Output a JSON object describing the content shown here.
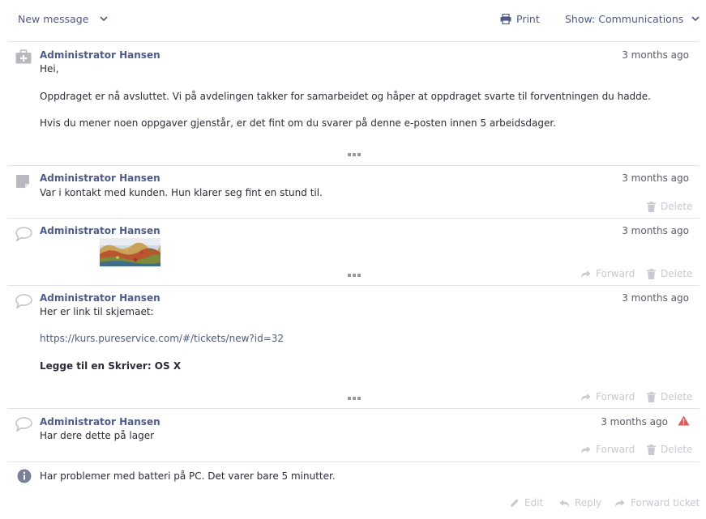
{
  "toolbar": {
    "new_message": "New message",
    "print": "Print",
    "show": "Show: Communications"
  },
  "entries": [
    {
      "author": "Administrator Hansen",
      "time": "3 months ago",
      "lines": [
        "Hei,",
        "Oppdraget er nå avsluttet. Vi på avdelingen takker for samarbeidet og håper at oppdraget svarte til forventningen du hadde.",
        "Hvis du mener noen oppgaver gjenstår, er det fint om du svarer på denne e-posten innen 5 arbeidsdager."
      ],
      "icon": "medical-case-icon"
    },
    {
      "author": "Administrator Hansen",
      "time": "3 months ago",
      "lines": [
        "Var i kontakt med kunden. Hun klarer seg fint en stund til."
      ],
      "delete": "Delete",
      "icon": "note-icon"
    },
    {
      "author": "Administrator Hansen",
      "time": "3 months ago",
      "forward": "Forward",
      "delete": "Delete",
      "icon": "speech-bubble-icon"
    },
    {
      "author": "Administrator Hansen",
      "time": "3 months ago",
      "lines": [
        "Her er link til skjemaet:"
      ],
      "link": "https://kurs.pureservice.com/#/tickets/new?id=32",
      "bold_line": "Legge til en Skriver: OS X",
      "forward": "Forward",
      "delete": "Delete",
      "icon": "speech-bubble-icon"
    },
    {
      "author": "Administrator Hansen",
      "time": "3 months ago",
      "lines": [
        "Har dere dette på lager"
      ],
      "forward": "Forward",
      "delete": "Delete",
      "icon": "speech-bubble-icon",
      "alert_icon": "warning-icon"
    }
  ],
  "description": {
    "text": "Har problemer med batteri på PC. Det varer bare 5 minutter.",
    "icon": "info-icon"
  },
  "footer": {
    "edit": "Edit",
    "reply": "Reply",
    "forward_ticket": "Forward ticket"
  },
  "colors": {
    "accent": "#4e5b8a",
    "muted_action": "#c9c9cf",
    "warning": "#e05a5a",
    "separator": "#e2e2e6"
  }
}
